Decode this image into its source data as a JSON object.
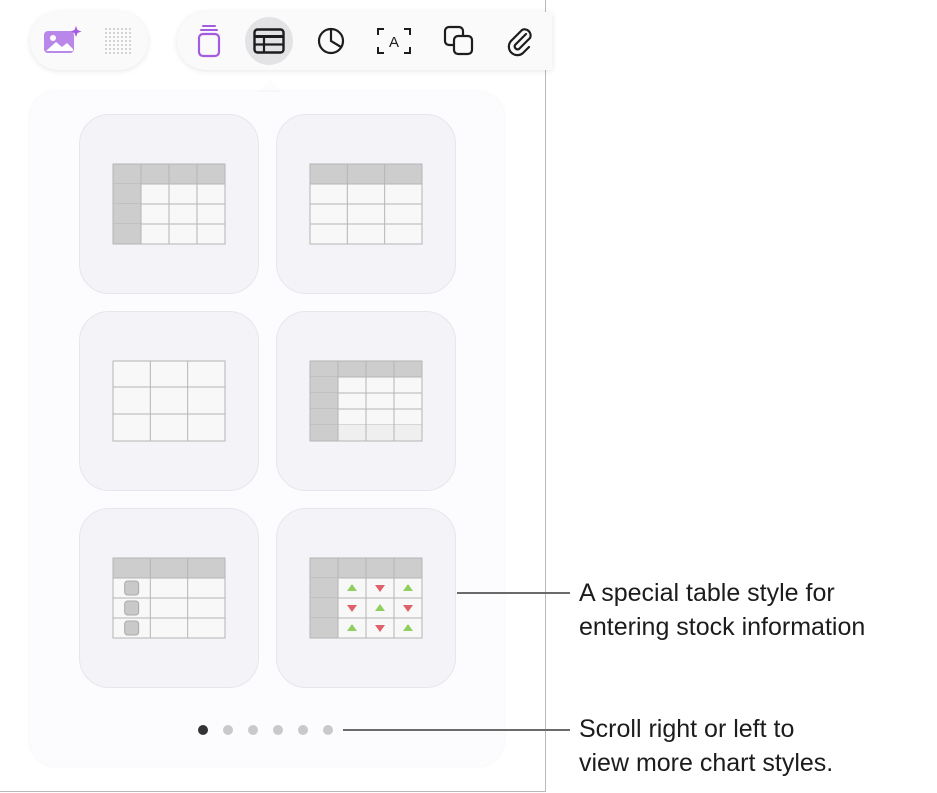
{
  "toolbar": {
    "left_icons": [
      "image-sparkle-icon",
      "dot-grid-icon"
    ],
    "right_icons": [
      "shape-stack-icon",
      "table-icon",
      "chart-pie-icon",
      "text-box-icon",
      "shapes-icon",
      "paperclip-icon"
    ],
    "selected": "table-icon",
    "text_box_glyph": "A",
    "accent_color": "#a35ce0"
  },
  "table_styles": [
    {
      "id": "style-1"
    },
    {
      "id": "style-2"
    },
    {
      "id": "style-3"
    },
    {
      "id": "style-4"
    },
    {
      "id": "style-5"
    },
    {
      "id": "style-6-stock"
    }
  ],
  "pagination": {
    "total": 6,
    "current": 1
  },
  "callouts": {
    "stock": {
      "line1": "A special table style for",
      "line2": "entering stock information"
    },
    "scroll": {
      "line1": "Scroll right or left to",
      "line2": "view more chart styles."
    }
  },
  "colors": {
    "header": "#cdcdcd",
    "cell": "#f8f8f8",
    "grid": "#b5b5b5",
    "up_arrow": "#8fcf5e",
    "down_arrow": "#e0616a"
  }
}
